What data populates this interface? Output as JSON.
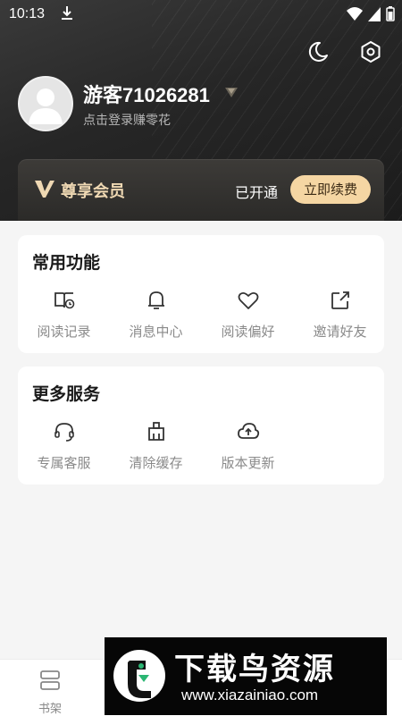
{
  "status_bar": {
    "time": "10:13"
  },
  "profile": {
    "username": "游客71026281",
    "subtitle": "点击登录赚零花"
  },
  "vip": {
    "title": "尊享会员",
    "status": "已开通",
    "renew_label": "立即续费"
  },
  "common_functions": {
    "title": "常用功能",
    "items": [
      {
        "label": "阅读记录",
        "icon": "reading-history-icon"
      },
      {
        "label": "消息中心",
        "icon": "bell-icon"
      },
      {
        "label": "阅读偏好",
        "icon": "heart-icon"
      },
      {
        "label": "邀请好友",
        "icon": "share-icon"
      }
    ]
  },
  "more_services": {
    "title": "更多服务",
    "items": [
      {
        "label": "专属客服",
        "icon": "headset-icon"
      },
      {
        "label": "清除缓存",
        "icon": "broom-icon"
      },
      {
        "label": "版本更新",
        "icon": "cloud-upload-icon"
      }
    ]
  },
  "bottom_nav": {
    "items": [
      {
        "label": "书架",
        "icon": "bookshelf-icon"
      }
    ]
  },
  "watermark": {
    "title": "下载鸟资源",
    "url": "www.xiazainiao.com"
  },
  "colors": {
    "header_bg": "#262626",
    "vip_gold": "#f5d6a3",
    "page_bg": "#f5f5f5"
  }
}
